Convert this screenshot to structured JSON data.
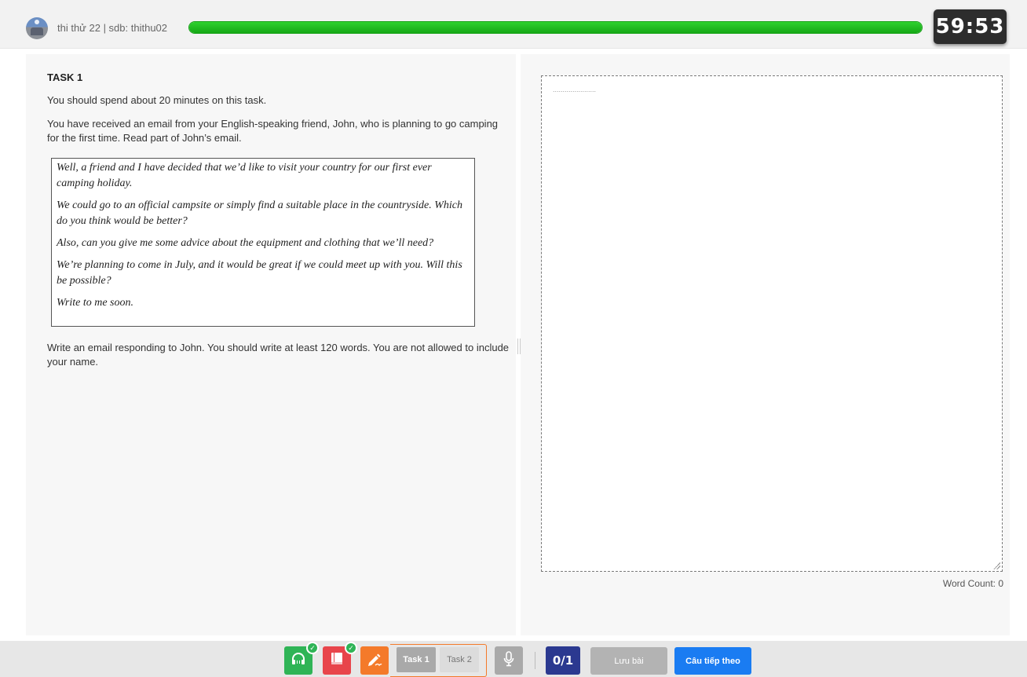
{
  "header": {
    "user_text": "thi thử 22  |  sdb: thithu02",
    "progress_fraction": 1.0,
    "timer": "59:53"
  },
  "task": {
    "title": "TASK 1",
    "instruction_time": "You should spend about 20 minutes on this task.",
    "instruction_context": "You have received an email from your English-speaking friend, John, who is planning to go camping for the first time. Read part of John’s email.",
    "email_paragraphs": [
      "Well, a friend and I have decided that we’d like to visit your country for our first ever camping holiday.",
      "We could go to an official campsite or simply find a suitable place in the countryside. Which do you think would be better?",
      "Also, can you give me some advice about the equipment and clothing that we’ll need?",
      "We’re planning to come in July, and it would be great if we could meet up with you. Will this be possible?",
      "Write to me soon."
    ],
    "instruction_write": "Write an email responding to John. You should write at least 120 words. You are not allowed to include your name."
  },
  "answer": {
    "placeholder": "......................",
    "value": "",
    "word_count_label": "Word Count: 0"
  },
  "footer": {
    "icons": {
      "listening": "headphones-icon",
      "reading": "book-icon",
      "writing": "pen-writing-icon",
      "speaking": "microphone-icon"
    },
    "check_mark": "✓",
    "task_tabs": [
      "Task 1",
      "Task 2"
    ],
    "counter": "0/1",
    "save_label": "Lưu bài",
    "next_label": "Câu tiếp theo"
  },
  "colors": {
    "progress": "#18b418",
    "listening": "#2fb456",
    "reading": "#e8454b",
    "writing": "#f47a2a",
    "counter": "#2b3990",
    "next": "#1a7cf2"
  }
}
